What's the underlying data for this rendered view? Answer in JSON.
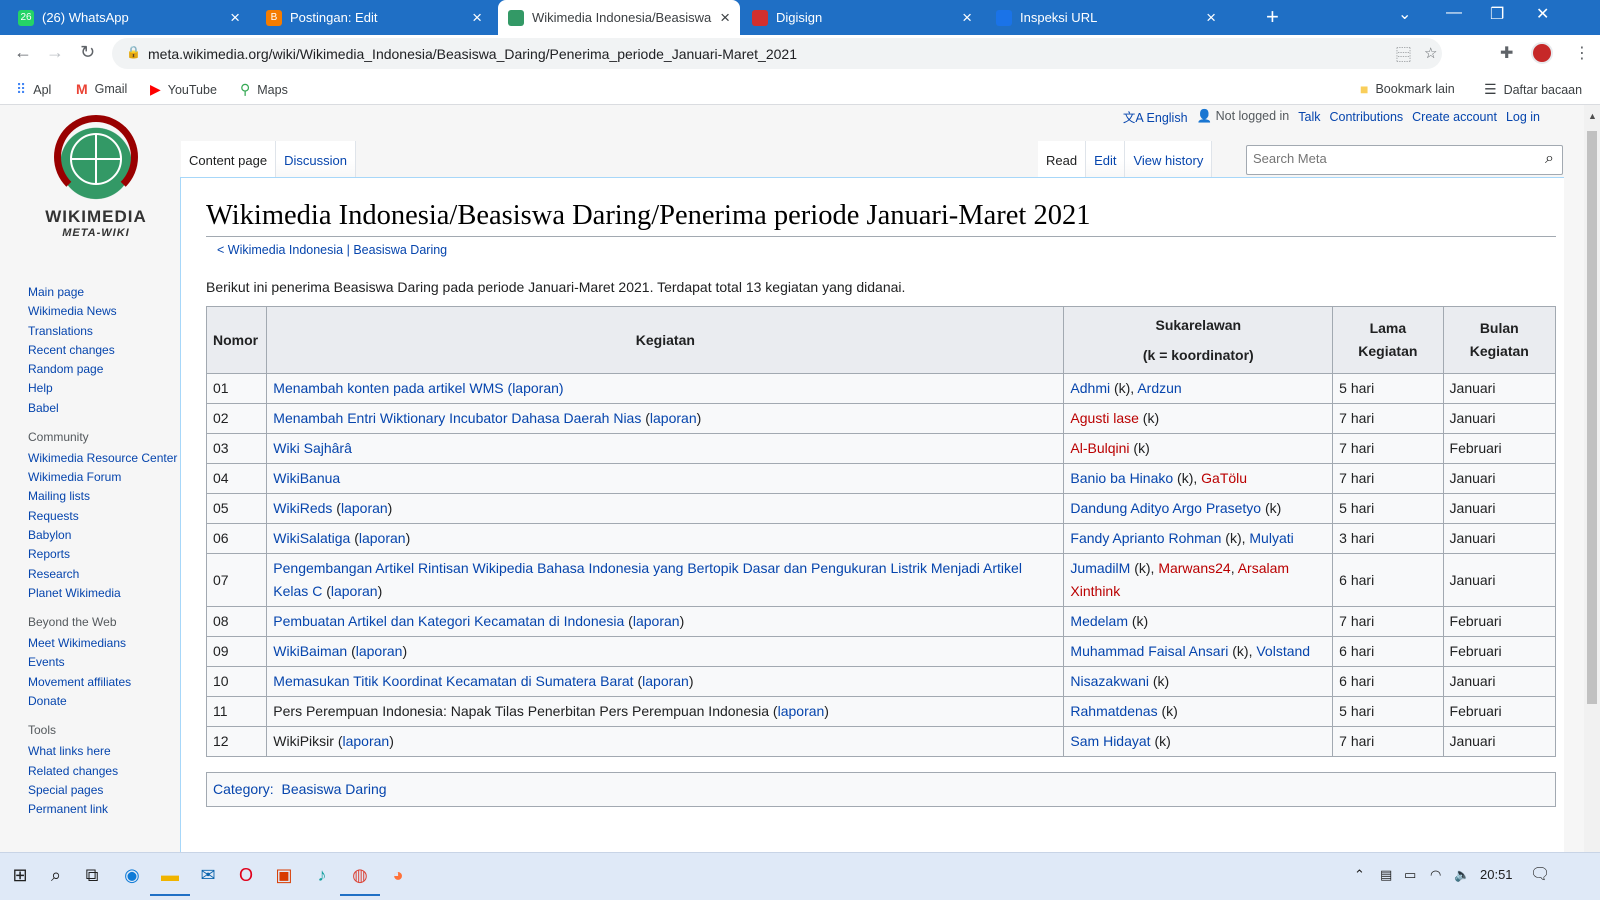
{
  "browser": {
    "tabs": [
      {
        "title": "(26) WhatsApp",
        "icon": "whatsapp-icon",
        "color": "#25d366",
        "badge": "26"
      },
      {
        "title": "Postingan: Edit",
        "icon": "blogger-icon",
        "color": "#f57c00",
        "badge": "B"
      },
      {
        "title": "Wikimedia Indonesia/Beasiswa D",
        "icon": "wikimedia-icon",
        "color": "#339966",
        "badge": ""
      },
      {
        "title": "Digisign",
        "icon": "digisign-icon",
        "color": "#d32f2f",
        "badge": ""
      },
      {
        "title": "Inspeksi URL",
        "icon": "search-console-icon",
        "color": "#1a73e8",
        "badge": ""
      }
    ],
    "url": "meta.wikimedia.org/wiki/Wikimedia_Indonesia/Beasiswa_Daring/Penerima_periode_Januari-Maret_2021",
    "bookmarks": [
      {
        "label": "Apl",
        "icon": "apps-grid-icon"
      },
      {
        "label": "Gmail",
        "icon": "gmail-icon"
      },
      {
        "label": "YouTube",
        "icon": "youtube-icon"
      },
      {
        "label": "Maps",
        "icon": "maps-icon"
      }
    ],
    "bookmarks_other": "Bookmark lain",
    "reading_list": "Daftar bacaan"
  },
  "wiki": {
    "logo_title": "WIKIMEDIA",
    "logo_sub": "META-WIKI",
    "user_nav": {
      "language": "English",
      "not_logged": "Not logged in",
      "talk": "Talk",
      "contributions": "Contributions",
      "create_account": "Create account",
      "login": "Log in"
    },
    "tabs_left": [
      "Content page",
      "Discussion"
    ],
    "tabs_right": [
      "Read",
      "Edit",
      "View history"
    ],
    "search_placeholder": "Search Meta",
    "sidebar": {
      "main": [
        "Main page",
        "Wikimedia News",
        "Translations",
        "Recent changes",
        "Random page",
        "Help",
        "Babel"
      ],
      "community_heading": "Community",
      "community": [
        "Wikimedia Resource Center",
        "Wikimedia Forum",
        "Mailing lists",
        "Requests",
        "Babylon",
        "Reports",
        "Research",
        "Planet Wikimedia"
      ],
      "beyond_heading": "Beyond the Web",
      "beyond": [
        "Meet Wikimedians",
        "Events",
        "Movement affiliates",
        "Donate"
      ],
      "tools_heading": "Tools",
      "tools": [
        "What links here",
        "Related changes",
        "Special pages",
        "Permanent link"
      ]
    },
    "title": "Wikimedia Indonesia/Beasiswa Daring/Penerima periode Januari-Maret 2021",
    "breadcrumb": {
      "prefix": "< ",
      "first": "Wikimedia Indonesia",
      "sep": " | ",
      "second": "Beasiswa Daring"
    },
    "intro": "Berikut ini penerima Beasiswa Daring pada periode Januari-Maret 2021. Terdapat total 13 kegiatan yang didanai.",
    "table": {
      "headers": {
        "nomor": "Nomor",
        "kegiatan": "Kegiatan",
        "sukarelawan_1": "Sukarelawan",
        "sukarelawan_2": "(k = koordinator)",
        "lama_1": "Lama",
        "lama_2": "Kegiatan",
        "bulan_1": "Bulan",
        "bulan_2": "Kegiatan"
      },
      "rows": [
        {
          "no": "01",
          "kegiatan": [
            {
              "t": "Menambah konten pada artikel WMS",
              "c": "lnk"
            },
            {
              "t": " (",
              "c": "lnk"
            },
            {
              "t": "laporan",
              "c": "lnk"
            },
            {
              "t": ")",
              "c": "lnk"
            }
          ],
          "sukarelawan": [
            {
              "t": "Adhmi",
              "c": "lnk"
            },
            {
              "t": " (k), ",
              "c": ""
            },
            {
              "t": "Ardzun",
              "c": "lnk"
            }
          ],
          "lama": "5 hari",
          "bulan": "Januari"
        },
        {
          "no": "02",
          "kegiatan": [
            {
              "t": "Menambah Entri Wiktionary Incubator Dahasa Daerah Nias",
              "c": "lnk"
            },
            {
              "t": " (",
              "c": ""
            },
            {
              "t": "laporan",
              "c": "lnk"
            },
            {
              "t": ")",
              "c": ""
            }
          ],
          "sukarelawan": [
            {
              "t": "Agusti lase",
              "c": "red"
            },
            {
              "t": " (k)",
              "c": ""
            }
          ],
          "lama": "7 hari",
          "bulan": "Januari"
        },
        {
          "no": "03",
          "kegiatan": [
            {
              "t": "Wiki Sajhârâ",
              "c": "lnk"
            }
          ],
          "sukarelawan": [
            {
              "t": "Al-Bulqini",
              "c": "red"
            },
            {
              "t": " (k)",
              "c": ""
            }
          ],
          "lama": "7 hari",
          "bulan": "Februari"
        },
        {
          "no": "04",
          "kegiatan": [
            {
              "t": "WikiBanua",
              "c": "lnk"
            }
          ],
          "sukarelawan": [
            {
              "t": "Banio ba Hinako",
              "c": "lnk"
            },
            {
              "t": " (k), ",
              "c": ""
            },
            {
              "t": "GaTölu",
              "c": "red"
            }
          ],
          "lama": "7 hari",
          "bulan": "Januari"
        },
        {
          "no": "05",
          "kegiatan": [
            {
              "t": "WikiReds",
              "c": "lnk"
            },
            {
              "t": " (",
              "c": ""
            },
            {
              "t": "laporan",
              "c": "lnk"
            },
            {
              "t": ")",
              "c": ""
            }
          ],
          "sukarelawan": [
            {
              "t": "Dandung Adityo Argo Prasetyo",
              "c": "lnk"
            },
            {
              "t": " (k)",
              "c": ""
            }
          ],
          "lama": "5 hari",
          "bulan": "Januari"
        },
        {
          "no": "06",
          "kegiatan": [
            {
              "t": "WikiSalatiga",
              "c": "lnk"
            },
            {
              "t": " (",
              "c": ""
            },
            {
              "t": "laporan",
              "c": "lnk"
            },
            {
              "t": ")",
              "c": ""
            }
          ],
          "sukarelawan": [
            {
              "t": "Fandy Aprianto Rohman",
              "c": "lnk"
            },
            {
              "t": " (k), ",
              "c": ""
            },
            {
              "t": "Mulyati",
              "c": "lnk"
            }
          ],
          "lama": "3 hari",
          "bulan": "Januari"
        },
        {
          "no": "07",
          "tall": true,
          "kegiatan": [
            {
              "t": "Pengembangan Artikel Rintisan Wikipedia Bahasa Indonesia yang Bertopik Dasar dan Pengukuran Listrik Menjadi Artikel Kelas C",
              "c": "lnk"
            },
            {
              "t": " (",
              "c": ""
            },
            {
              "t": "laporan",
              "c": "lnk"
            },
            {
              "t": ")",
              "c": ""
            }
          ],
          "sukarelawan": [
            {
              "t": "JumadilM",
              "c": "lnk"
            },
            {
              "t": " (k), ",
              "c": ""
            },
            {
              "t": "Marwans24",
              "c": "red"
            },
            {
              "t": ", ",
              "c": ""
            },
            {
              "t": "Arsalam Xinthink",
              "c": "red"
            }
          ],
          "lama": "6 hari",
          "bulan": "Januari"
        },
        {
          "no": "08",
          "kegiatan": [
            {
              "t": "Pembuatan Artikel dan Kategori Kecamatan di Indonesia",
              "c": "lnk"
            },
            {
              "t": " (",
              "c": ""
            },
            {
              "t": "laporan",
              "c": "lnk"
            },
            {
              "t": ")",
              "c": ""
            }
          ],
          "sukarelawan": [
            {
              "t": "Medelam",
              "c": "lnk"
            },
            {
              "t": " (k)",
              "c": ""
            }
          ],
          "lama": "7 hari",
          "bulan": "Februari"
        },
        {
          "no": "09",
          "kegiatan": [
            {
              "t": "WikiBaiman",
              "c": "lnk"
            },
            {
              "t": " (",
              "c": ""
            },
            {
              "t": "laporan",
              "c": "lnk"
            },
            {
              "t": ")",
              "c": ""
            }
          ],
          "sukarelawan": [
            {
              "t": "Muhammad Faisal Ansari",
              "c": "lnk"
            },
            {
              "t": " (k), ",
              "c": ""
            },
            {
              "t": "Volstand",
              "c": "lnk"
            }
          ],
          "lama": "6 hari",
          "bulan": "Februari"
        },
        {
          "no": "10",
          "kegiatan": [
            {
              "t": "Memasukan Titik Koordinat Kecamatan di Sumatera Barat",
              "c": "lnk"
            },
            {
              "t": " (",
              "c": ""
            },
            {
              "t": "laporan",
              "c": "lnk"
            },
            {
              "t": ")",
              "c": ""
            }
          ],
          "sukarelawan": [
            {
              "t": "Nisazakwani",
              "c": "lnk"
            },
            {
              "t": " (k)",
              "c": ""
            }
          ],
          "lama": "6 hari",
          "bulan": "Januari"
        },
        {
          "no": "11",
          "kegiatan": [
            {
              "t": "Pers Perempuan Indonesia: Napak Tilas Penerbitan Pers Perempuan Indonesia",
              "c": ""
            },
            {
              "t": " (",
              "c": ""
            },
            {
              "t": "laporan",
              "c": "lnk"
            },
            {
              "t": ")",
              "c": ""
            }
          ],
          "sukarelawan": [
            {
              "t": "Rahmatdenas",
              "c": "lnk"
            },
            {
              "t": " (k)",
              "c": ""
            }
          ],
          "lama": "5 hari",
          "bulan": "Februari"
        },
        {
          "no": "12",
          "kegiatan": [
            {
              "t": "WikiPiksir",
              "c": ""
            },
            {
              "t": " (",
              "c": ""
            },
            {
              "t": "laporan",
              "c": "lnk"
            },
            {
              "t": ")",
              "c": ""
            }
          ],
          "sukarelawan": [
            {
              "t": "Sam Hidayat",
              "c": "lnk"
            },
            {
              "t": " (k)",
              "c": ""
            }
          ],
          "lama": "7 hari",
          "bulan": "Januari"
        }
      ]
    },
    "category_label": "Category:",
    "category_value": "Beasiswa Daring"
  },
  "taskbar": {
    "clock": "20:51",
    "apps": [
      "windows-start-icon",
      "search-icon",
      "task-view-icon",
      "edge-icon",
      "file-explorer-icon",
      "mail-icon",
      "opera-icon",
      "office-icon",
      "app-icon",
      "chrome-icon",
      "firefox-icon"
    ]
  }
}
